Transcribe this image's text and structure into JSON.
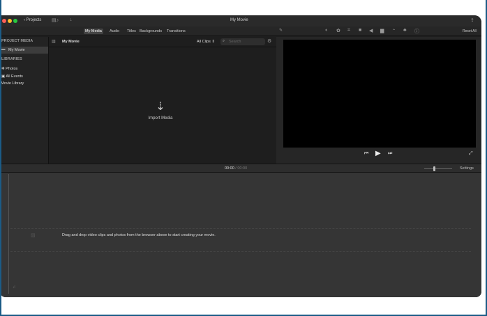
{
  "window": {
    "title": "My Movie",
    "back_label": "Projects"
  },
  "toolbar": {
    "tabs": [
      "My Media",
      "Audio",
      "Titles",
      "Backgrounds",
      "Transitions"
    ],
    "active_tab": "My Media",
    "reset_all": "Reset All"
  },
  "sidebar": {
    "project_media_header": "PROJECT MEDIA",
    "project_item": "My Movie",
    "libraries_header": "LIBRARIES",
    "items": [
      "Photos",
      "All Events",
      "iMovie Library"
    ]
  },
  "browser": {
    "title": "My Movie",
    "filter": "All Clips",
    "search_placeholder": "Search",
    "import_label": "Import Media"
  },
  "timeline": {
    "current_time": "00:00",
    "total_time": "00:00",
    "settings_label": "Settings",
    "hint": "Drag and drop video clips and photos from the browser above to start creating your movie."
  }
}
